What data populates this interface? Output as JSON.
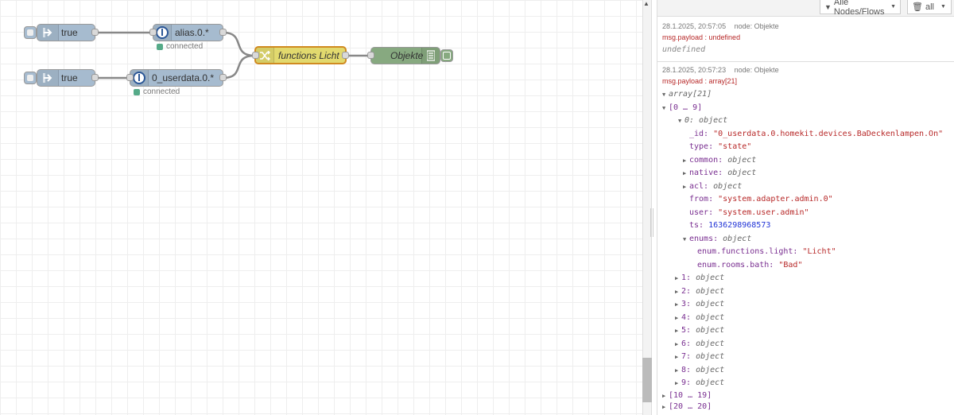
{
  "flow": {
    "inject_nodes": [
      {
        "label": "true"
      },
      {
        "label": "true"
      }
    ],
    "ioin_nodes": [
      {
        "label": "alias.0.*",
        "status": "connected"
      },
      {
        "label": "0_userdata.0.*",
        "status": "connected"
      }
    ],
    "switch_node": {
      "label": "functions Licht"
    },
    "debug_node": {
      "label": "Objekte"
    }
  },
  "sidebar": {
    "filter_label": "Alle Nodes/Flows",
    "clear_label": "all",
    "messages": [
      {
        "timestamp": "28.1.2025, 20:57:05",
        "node": "node: Objekte",
        "topic": "msg.payload : undefined",
        "value": "undefined"
      },
      {
        "timestamp": "28.1.2025, 20:57:23",
        "node": "node: Objekte",
        "topic": "msg.payload : array[21]",
        "root": "array[21]",
        "group_first": "[0 … 9]",
        "item0": "0: object",
        "fields": {
          "id_key": "_id:",
          "id_val": "\"0_userdata.0.homekit.devices.BaDeckenlampen.On\"",
          "type_key": "type:",
          "type_val": "\"state\"",
          "common_key": "common:",
          "common_val": "object",
          "native_key": "native:",
          "native_val": "object",
          "acl_key": "acl:",
          "acl_val": "object",
          "from_key": "from:",
          "from_val": "\"system.adapter.admin.0\"",
          "user_key": "user:",
          "user_val": "\"system.user.admin\"",
          "ts_key": "ts:",
          "ts_val": "1636298968573",
          "enums_key": "enums:",
          "enums_val": "object",
          "enum_light_key": "enum.functions.light:",
          "enum_light_val": "\"Licht\"",
          "enum_bath_key": "enum.rooms.bath:",
          "enum_bath_val": "\"Bad\""
        },
        "items": [
          {
            "key": "1:",
            "type": "object"
          },
          {
            "key": "2:",
            "type": "object"
          },
          {
            "key": "3:",
            "type": "object"
          },
          {
            "key": "4:",
            "type": "object"
          },
          {
            "key": "5:",
            "type": "object"
          },
          {
            "key": "6:",
            "type": "object"
          },
          {
            "key": "7:",
            "type": "object"
          },
          {
            "key": "8:",
            "type": "object"
          },
          {
            "key": "9:",
            "type": "object"
          }
        ],
        "groups": [
          "[10 … 19]",
          "[20 … 20]"
        ]
      }
    ]
  }
}
